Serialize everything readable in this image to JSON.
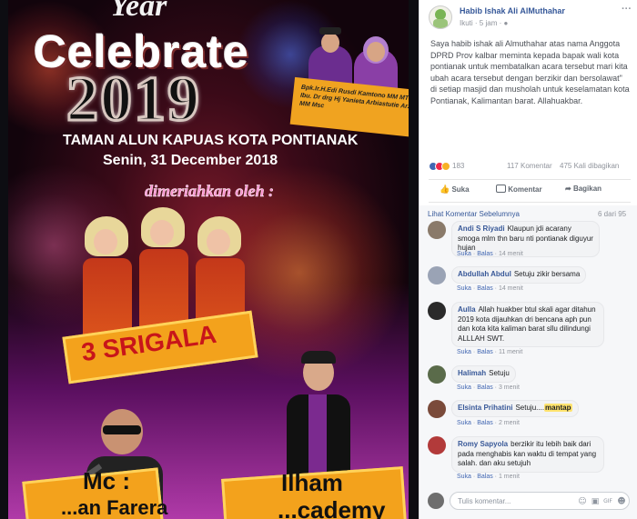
{
  "poster": {
    "year_text": "Year",
    "celebrate_text": "Celebrate",
    "number_text": "2019",
    "venue_text": "TAMAN ALUN KAPUAS KOTA PONTIANAK",
    "date_text": "Senin, 31 December 2018",
    "dimeriahkan_text": "dimeriahkan oleh :",
    "officials_caption": [
      "Bpk.Ir.H.Edi Rusdi Kamtono MM MT",
      "Ibu. Dr drg Hj Yanieta Arbiastutie Arz MM Msc"
    ],
    "group_banner": "3 SRIGALA",
    "mc_label": "Mc :",
    "mc_name": "...an Farera",
    "ilham_label": "Ilham",
    "ilham_name": "...cademy"
  },
  "post": {
    "author": "Habib Ishak Ali AlMuthahar",
    "follow": "Ikuti",
    "time": "5 jam",
    "audience_icon": "globe-icon",
    "text": "Saya habib ishak ali Almuthahar atas nama Anggota DPRD Prov kalbar meminta kepada bapak wali kota pontianak untuk membatalkan acara tersebut mari kita ubah acara tersebut dengan berzikir dan bersolawat\" di setiap masjid dan musholah untuk keselamatan kota Pontianak, Kalimantan barat. Allahuakbar.",
    "reactions_count": "183",
    "comments_count": "117 Komentar",
    "shares_count": "475 Kali dibagikan",
    "actions": {
      "like": "Suka",
      "comment": "Komentar",
      "share": "Bagikan"
    }
  },
  "comments_section": {
    "previous_link": "Lihat Komentar Sebelumnya",
    "page_count": "6 dari 95",
    "items": [
      {
        "name": "Andi S Riyadi",
        "text": "Klaupun jdi acarany smoga mlm thn baru nti pontianak diguyur hujan",
        "like": "Suka",
        "reply": "Balas",
        "time": "14 menit"
      },
      {
        "name": "Abdullah Abdul",
        "text": "Setuju zikir bersama",
        "like": "Suka",
        "reply": "Balas",
        "time": "14 menit"
      },
      {
        "name": "Aulla",
        "text": "Allah huakber btul skali agar ditahun 2019 kota dijauhkan dri bencana aph pun dan kota kita kaliman barat sllu dilindungi ALLLAH SWT.",
        "like": "Suka",
        "reply": "Balas",
        "time": "11 menit"
      },
      {
        "name": "Halimah",
        "text": "Setuju",
        "like": "Suka",
        "reply": "Balas",
        "time": "3 menit"
      },
      {
        "name": "Elsinta Prihatini",
        "text": "Setuju....",
        "tag": "mantap",
        "like": "Suka",
        "reply": "Balas",
        "time": "2 menit"
      },
      {
        "name": "Romy Sapyola",
        "text": "berzikir itu lebih baik dari pada menghabis kan waktu di tempat yang salah. dan aku setujuh",
        "like": "Suka",
        "reply": "Balas",
        "time": "1 menit"
      }
    ]
  },
  "composer": {
    "placeholder": "Tulis komentar...",
    "icons": [
      "emoji-icon",
      "camera-icon",
      "gif-icon",
      "sticker-icon"
    ]
  },
  "colors": {
    "link": "#365899",
    "muted": "#90949c",
    "banner": "#f3a21c",
    "banner_text": "#c8151a"
  }
}
